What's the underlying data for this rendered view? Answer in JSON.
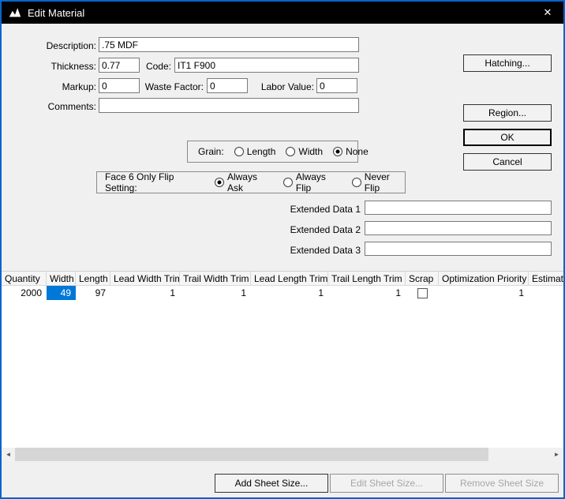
{
  "window": {
    "title": "Edit Material",
    "close_glyph": "✕"
  },
  "colors": {
    "window_border": "#0a64cc",
    "titlebar_bg": "#000000",
    "selection_bg": "#0078d7",
    "dialog_bg": "#f0f0f0"
  },
  "form": {
    "description": {
      "label": "Description:",
      "value": ".75 MDF"
    },
    "thickness": {
      "label": "Thickness:",
      "value": "0.77"
    },
    "code": {
      "label": "Code:",
      "value": "IT1 F900"
    },
    "markup": {
      "label": "Markup:",
      "value": "0"
    },
    "waste_factor": {
      "label": "Waste Factor:",
      "value": "0"
    },
    "labor_value": {
      "label": "Labor Value:",
      "value": "0"
    },
    "comments": {
      "label": "Comments:",
      "value": ""
    }
  },
  "side_buttons": {
    "hatching": "Hatching...",
    "region": "Region...",
    "ok": "OK",
    "cancel": "Cancel"
  },
  "grain": {
    "label": "Grain:",
    "options": [
      {
        "label": "Length",
        "selected": false
      },
      {
        "label": "Width",
        "selected": false
      },
      {
        "label": "None",
        "selected": true
      }
    ]
  },
  "face6": {
    "label": "Face 6 Only Flip Setting:",
    "options": [
      {
        "label": "Always Ask",
        "selected": true
      },
      {
        "label": "Always Flip",
        "selected": false
      },
      {
        "label": "Never Flip",
        "selected": false
      }
    ]
  },
  "extended_data": [
    {
      "label": "Extended Data 1",
      "value": ""
    },
    {
      "label": "Extended Data 2",
      "value": ""
    },
    {
      "label": "Extended Data 3",
      "value": ""
    }
  ],
  "table": {
    "columns": [
      "Quantity",
      "Width",
      "Length",
      "Lead Width Trim",
      "Trail Width Trim",
      "Lead Length Trim",
      "Trail Length Trim",
      "Scrap",
      "Optimization Priority",
      "Estimat"
    ],
    "rows": [
      {
        "quantity": "2000",
        "width": "49",
        "length": "97",
        "lead_width_trim": "1",
        "trail_width_trim": "1",
        "lead_length_trim": "1",
        "trail_length_trim": "1",
        "scrap": false,
        "optimization_priority": "1",
        "estimat": ""
      }
    ],
    "selected_cell": "width"
  },
  "scrollbar": {
    "left_glyph": "◄",
    "right_glyph": "►"
  },
  "sheet_buttons": {
    "add": "Add Sheet Size...",
    "edit": "Edit Sheet Size...",
    "remove": "Remove Sheet Size"
  }
}
